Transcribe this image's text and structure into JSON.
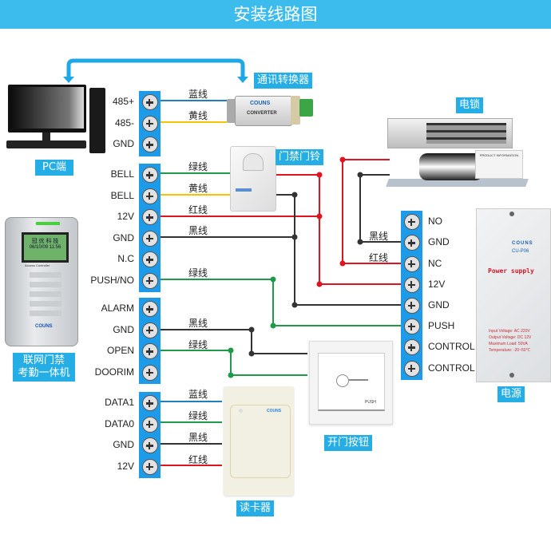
{
  "title": "安装线路图",
  "colors": {
    "header": "#3cbcec",
    "tag": "#25aee6",
    "strip": "#1e9be8",
    "blue_wire": "#1f7fc3",
    "yellow_wire": "#f5c400",
    "green_wire": "#1f9a4a",
    "red_wire": "#e0141e",
    "black_wire": "#333333"
  },
  "devices": {
    "pc": {
      "label": "PC端"
    },
    "converter": {
      "label": "通讯转换器",
      "brand": "COUNS",
      "text": "CONVERTER"
    },
    "doorbell": {
      "label": "门禁门铃"
    },
    "lock": {
      "label": "电锁",
      "info": "PRODUCT INFORMATION"
    },
    "controller": {
      "label_line1": "联网门禁",
      "label_line2": "考勤一体机",
      "screen_line1": "冠 优 科 技",
      "screen_line2": "06/10/09 11:56",
      "brand": "COUNS",
      "subtitle": "Access Controller"
    },
    "power": {
      "label": "电源",
      "brand": "COUNS",
      "model": "CU-P06",
      "title": "Power supply",
      "specs": [
        "Input Voltage:  AC 220V",
        "Output Voltage:  DC  12V",
        "Maximum Load:  50VA",
        "Temperature:  -20~50℃"
      ]
    },
    "exit_button": {
      "label": "开门按钮",
      "text": "PUSH"
    },
    "reader": {
      "label": "读卡器",
      "brand": "COUNS"
    }
  },
  "terminals": {
    "comm": [
      "485+",
      "485-",
      "GND"
    ],
    "bell_group": [
      "BELL",
      "BELL",
      "12V",
      "GND",
      "N.C",
      "PUSH/NO"
    ],
    "alarm_group": [
      "ALARM",
      "GND",
      "OPEN",
      "DOORIM"
    ],
    "reader_group": [
      "DATA1",
      "DATA0",
      "GND",
      "12V"
    ],
    "power_group": [
      "NO",
      "GND",
      "NC",
      "12V",
      "GND",
      "PUSH",
      "CONTROL",
      "CONTROL"
    ]
  },
  "wire_labels": {
    "comm": [
      "蓝线",
      "黄线"
    ],
    "bell": [
      "绿线",
      "黄线",
      "红线",
      "黑线",
      "绿线"
    ],
    "alarm": [
      "黑线",
      "绿线"
    ],
    "reader": [
      "蓝线",
      "绿线",
      "黑线",
      "红线"
    ],
    "power": [
      "黑线",
      "红线"
    ]
  }
}
